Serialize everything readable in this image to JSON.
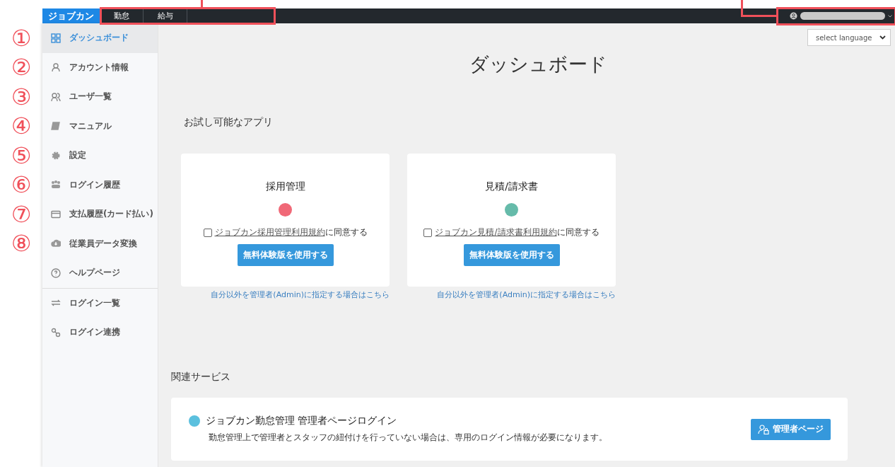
{
  "annotations": {
    "markers": [
      "①",
      "②",
      "③",
      "④",
      "⑤",
      "⑥",
      "⑦",
      "⑧"
    ]
  },
  "topbar": {
    "logo": "ジョブカン",
    "tabs": [
      {
        "label": "勤怠",
        "selected": false
      },
      {
        "label": "給与",
        "selected": false
      }
    ]
  },
  "sidebar": {
    "sections": [
      [
        {
          "label": "ダッシュボード",
          "selected": true
        },
        {
          "label": "アカウント情報",
          "selected": false
        },
        {
          "label": "ユーザ一覧",
          "selected": false
        },
        {
          "label": "マニュアル",
          "selected": false
        },
        {
          "label": "設定",
          "selected": false
        },
        {
          "label": "ログイン履歴",
          "selected": false
        },
        {
          "label": "支払履歴(カード払い)",
          "selected": false
        },
        {
          "label": "従業員データ変換",
          "selected": false
        },
        {
          "label": "ヘルプページ",
          "selected": false
        }
      ],
      [
        {
          "label": "ログイン一覧",
          "selected": false
        },
        {
          "label": "ログイン連携",
          "selected": false
        }
      ]
    ]
  },
  "language_select": {
    "value": "select language"
  },
  "page_title": "ダッシュボード",
  "trial_section": {
    "heading": "お試し可能なアプリ",
    "apps": [
      {
        "title": "採用管理",
        "color": "#f06877",
        "checked": false,
        "terms_link": "ジョブカン採用管理利用規約",
        "terms_suffix": "に同意する",
        "button": "無料体験版を使用する",
        "admin_link": "自分以外を管理者(Admin)に指定する場合はこちら"
      },
      {
        "title": "見積/請求書",
        "color": "#66bbaa",
        "checked": false,
        "terms_link": "ジョブカン見積/請求書利用規約",
        "terms_suffix": "に同意する",
        "button": "無料体験版を使用する",
        "admin_link": "自分以外を管理者(Admin)に指定する場合はこちら"
      }
    ]
  },
  "related_section": {
    "heading": "関連サービス",
    "services": [
      {
        "title": "ジョブカン勤怠管理 管理者ページログイン",
        "color": "#5bc0de",
        "description": "勤怠管理上で管理者とスタッフの紐付けを行っていない場合は、専用のログイン情報が必要になります。",
        "button": "管理者ページ"
      }
    ]
  }
}
